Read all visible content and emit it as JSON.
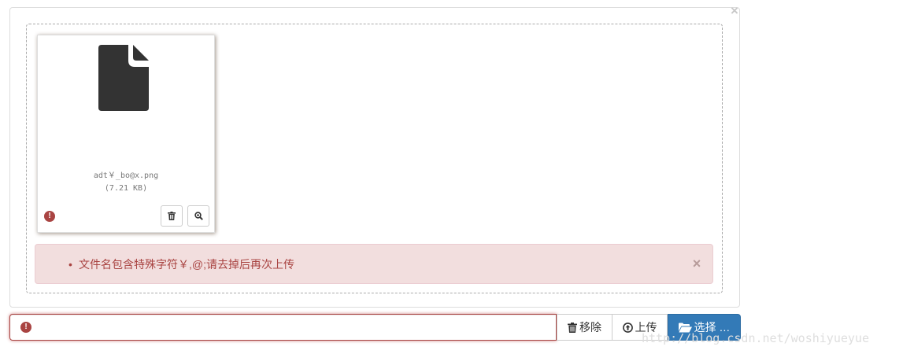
{
  "panel": {
    "close_glyph": "×"
  },
  "preview": {
    "file_name": "adt￥_bo@x.png",
    "file_size": "(7.21 KB)",
    "icons": [
      "file-icon",
      "error-icon",
      "trash-icon",
      "zoom-icon"
    ]
  },
  "error": {
    "messages": [
      "文件名包含特殊字符￥,@;请去掉后再次上传"
    ],
    "close_glyph": "×"
  },
  "toolbar": {
    "remove_label": "移除",
    "upload_label": "上传",
    "browse_label": "选择 …"
  },
  "watermark": "http://blog.csdn.net/woshiyueyue",
  "colors": {
    "error": "#a94442",
    "error_bg": "#f2dede",
    "primary": "#337ab7",
    "file_icon": "#333333"
  }
}
